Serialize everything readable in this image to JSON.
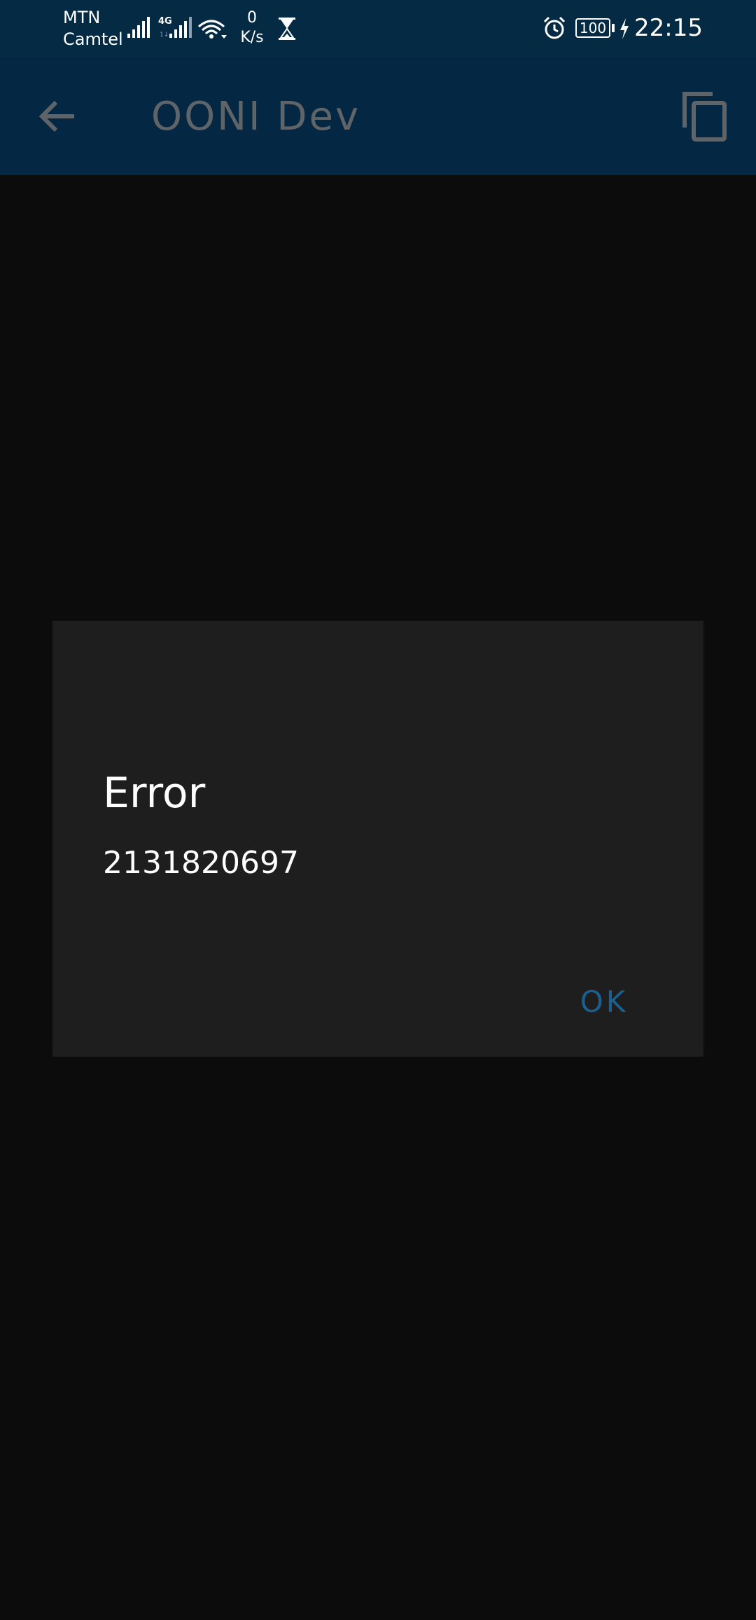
{
  "status_bar": {
    "carrier_1": "MTN",
    "carrier_2": "Camtel",
    "network_type": "4G",
    "speed_value": "0",
    "speed_unit": "K/s",
    "battery": "100",
    "time": "22:15",
    "icons": [
      "signal-icon",
      "signal-4g-icon",
      "wifi-icon",
      "hourglass-icon",
      "alarm-icon",
      "battery-icon",
      "charging-icon"
    ]
  },
  "app_bar": {
    "title": "OONI Dev",
    "icons": [
      "back-arrow-icon",
      "copy-icon"
    ]
  },
  "dialog": {
    "title": "Error",
    "message": "2131820697",
    "ok_label": "OK"
  },
  "colors": {
    "status_bar_bg": "#052a44",
    "app_bar_bg": "#042843",
    "background": "#0c0c0c",
    "dialog_bg": "#1e1e1e",
    "accent": "#1a5f8e",
    "title_text": "#5f6468"
  }
}
